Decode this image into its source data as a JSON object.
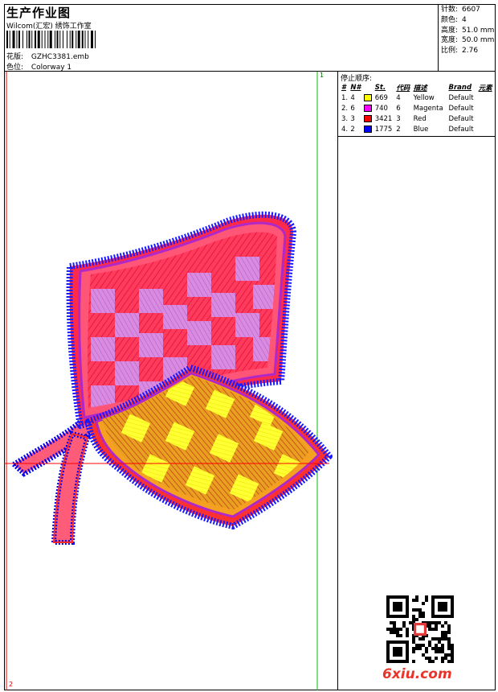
{
  "header": {
    "title": "生产作业图",
    "company": "Wilcom(汇宏) 绣饰工作室",
    "design_label": "花版:",
    "design_value": "GZHC3381.emb",
    "colorway_label": "色位:",
    "colorway_value": "Colorway 1"
  },
  "stats": [
    {
      "label": "针数:",
      "value": "6607"
    },
    {
      "label": "颜色:",
      "value": "4"
    },
    {
      "label": "高度:",
      "value": "51.0 mm"
    },
    {
      "label": "宽度:",
      "value": "50.0 mm"
    },
    {
      "label": "比例:",
      "value": "2.76"
    }
  ],
  "stop_sequence": {
    "label": "停止顺序:",
    "columns": [
      "#",
      "N#",
      "St.",
      "代码",
      "描述",
      "Brand",
      "元素"
    ],
    "rows": [
      {
        "idx": "1.",
        "n": "4",
        "color": "#ffff00",
        "st": "669",
        "code": "4",
        "desc": "Yellow",
        "brand": "Default"
      },
      {
        "idx": "2.",
        "n": "6",
        "color": "#ff00ff",
        "st": "740",
        "code": "6",
        "desc": "Magenta",
        "brand": "Default"
      },
      {
        "idx": "3.",
        "n": "3",
        "color": "#ff0000",
        "st": "3421",
        "code": "3",
        "desc": "Red",
        "brand": "Default"
      },
      {
        "idx": "4.",
        "n": "2",
        "color": "#0000ff",
        "st": "1775",
        "code": "2",
        "desc": "Blue",
        "brand": "Default"
      }
    ]
  },
  "markers": {
    "top": "1",
    "bottom": "2"
  },
  "watermark": "6xiu.com"
}
